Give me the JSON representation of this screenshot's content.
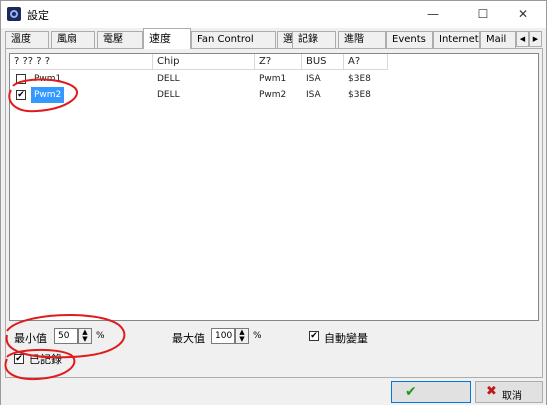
{
  "window": {
    "title": "設定",
    "controls": {
      "minimize": "—",
      "maximize": "☐",
      "close": "✕"
    }
  },
  "tabs": [
    {
      "label": "溫度"
    },
    {
      "label": "風扇"
    },
    {
      "label": "電壓"
    },
    {
      "label": "速度"
    },
    {
      "label": "Fan Control"
    },
    {
      "label": "選項"
    },
    {
      "label": "記錄"
    },
    {
      "label": "進階"
    },
    {
      "label": "Events"
    },
    {
      "label": "Internet"
    },
    {
      "label": "Mail"
    }
  ],
  "active_tab": "速度",
  "tab_scroll": {
    "left": "◀",
    "right": "▶"
  },
  "listview": {
    "columns": [
      "? ?? ?  ?",
      "Chip",
      "Z?",
      "BUS",
      "A?"
    ],
    "rows": [
      {
        "checked": false,
        "check_mark": "",
        "name": "Pwm1",
        "chip": "DELL",
        "z": "Pwm1",
        "bus": "ISA",
        "a": "$3E8",
        "selected": false
      },
      {
        "checked": true,
        "check_mark": "✔",
        "name": "Pwm2",
        "chip": "DELL",
        "z": "Pwm2",
        "bus": "ISA",
        "a": "$3E8",
        "selected": true
      }
    ]
  },
  "controls": {
    "min_label": "最小值",
    "min_value": "50",
    "min_unit": "%",
    "max_label": "最大值",
    "max_value": "100",
    "max_unit": "%",
    "auto_var_label": "自動變量",
    "auto_var_mark": "✔",
    "recorded_label": "已記錄",
    "recorded_mark": "✔"
  },
  "footer": {
    "ok_mark": "✔",
    "cancel_mark": "✖",
    "cancel_label": "取消"
  },
  "colors": {
    "selection": "#3399ff",
    "annotation": "#e01b1b",
    "ok_green": "#1c9a1c",
    "cancel_red": "#c01818"
  }
}
